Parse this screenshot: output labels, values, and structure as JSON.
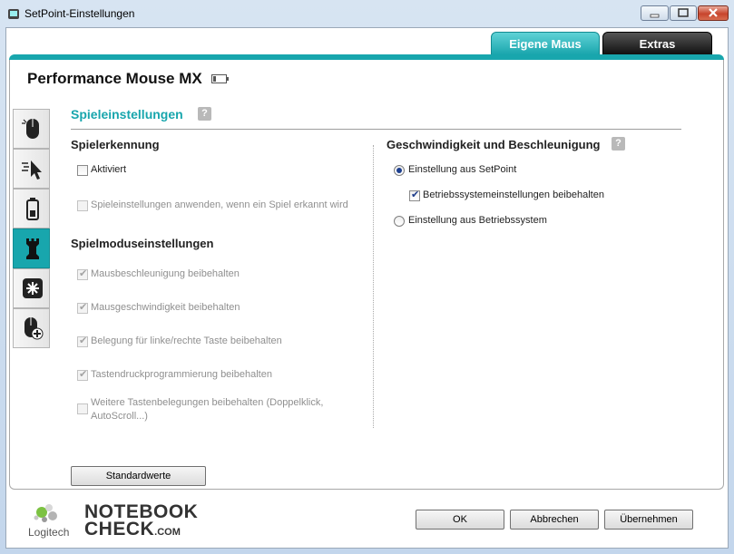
{
  "window": {
    "title": "SetPoint-Einstellungen"
  },
  "tabs": [
    {
      "label": "Eigene Maus",
      "active": true
    },
    {
      "label": "Extras",
      "active": false
    }
  ],
  "device": {
    "name": "Performance Mouse MX"
  },
  "sidebar": {
    "items": [
      {
        "icon": "mouse-icon",
        "active": false
      },
      {
        "icon": "pointer-speed-icon",
        "active": false
      },
      {
        "icon": "battery-icon",
        "active": false
      },
      {
        "icon": "chess-rook-icon",
        "active": true
      },
      {
        "icon": "snowflake-icon",
        "active": false
      },
      {
        "icon": "mouse-add-icon",
        "active": false
      }
    ]
  },
  "section": {
    "title": "Spieleinstellungen",
    "help": "?"
  },
  "left": {
    "game_detection": {
      "heading": "Spielerkennung",
      "activated": {
        "label": "Aktiviert",
        "checked": false
      },
      "apply": {
        "label": "Spieleinstellungen anwenden, wenn ein Spiel erkannt wird",
        "checked": false
      }
    },
    "game_mode": {
      "heading": "Spielmoduseinstellungen",
      "options": [
        {
          "label": "Mausbeschleunigung beibehalten",
          "checked": true
        },
        {
          "label": "Mausgeschwindigkeit beibehalten",
          "checked": true
        },
        {
          "label": "Belegung für linke/rechte Taste beibehalten",
          "checked": true
        },
        {
          "label": "Tastendruckprogrammierung beibehalten",
          "checked": true
        },
        {
          "label": "Weitere Tastenbelegungen beibehalten (Doppelklick, AutoScroll...)",
          "checked": false
        }
      ]
    }
  },
  "right": {
    "heading": "Geschwindigkeit und Beschleunigung",
    "help": "?",
    "setpoint": {
      "label": "Einstellung aus SetPoint",
      "selected": true
    },
    "keep_os": {
      "label": "Betriebssystemeinstellungen beibehalten",
      "checked": true
    },
    "os": {
      "label": "Einstellung aus Betriebssystem",
      "selected": false
    }
  },
  "buttons": {
    "defaults": "Standardwerte",
    "ok": "OK",
    "cancel": "Abbrechen",
    "apply": "Übernehmen"
  },
  "branding": {
    "logitech": "Logitech",
    "notebookcheck_line1": "NOTEBOOK",
    "notebookcheck_line2": "CHECK",
    "notebookcheck_suffix": ".COM"
  },
  "colors": {
    "accent": "#18a6ad"
  }
}
